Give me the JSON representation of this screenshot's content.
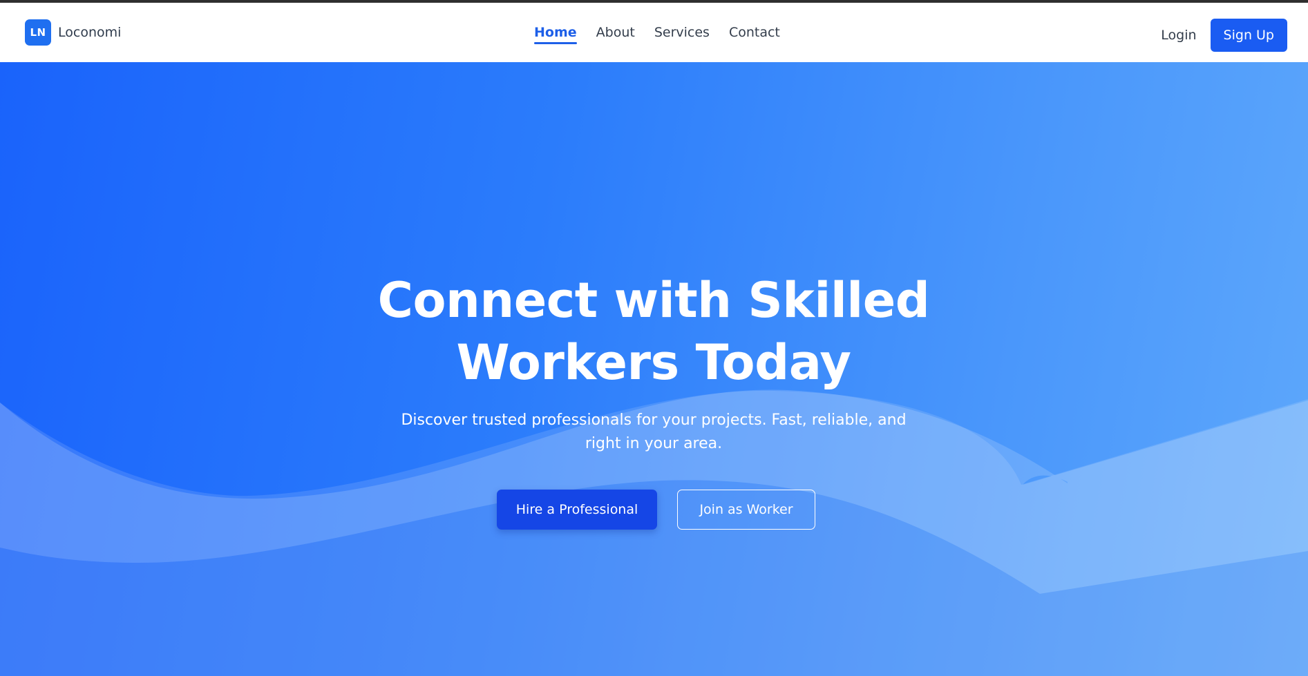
{
  "brand": {
    "logo_text": "LN",
    "name": "Loconomi"
  },
  "nav": {
    "links": [
      {
        "label": "Home",
        "active": true
      },
      {
        "label": "About",
        "active": false
      },
      {
        "label": "Services",
        "active": false
      },
      {
        "label": "Contact",
        "active": false
      }
    ],
    "login_label": "Login",
    "signup_label": "Sign Up"
  },
  "hero": {
    "title": "Connect with Skilled Workers Today",
    "subtitle": "Discover trusted professionals for your projects. Fast, reliable, and right in your area.",
    "primary_cta": "Hire a Professional",
    "secondary_cta": "Join as Worker"
  },
  "colors": {
    "accent": "#1a5cf2",
    "nav_active": "#1d5fe8",
    "hero_gradient_start": "#1a63fb",
    "hero_gradient_end": "#5ea8fb",
    "primary_button": "#1546e6"
  }
}
